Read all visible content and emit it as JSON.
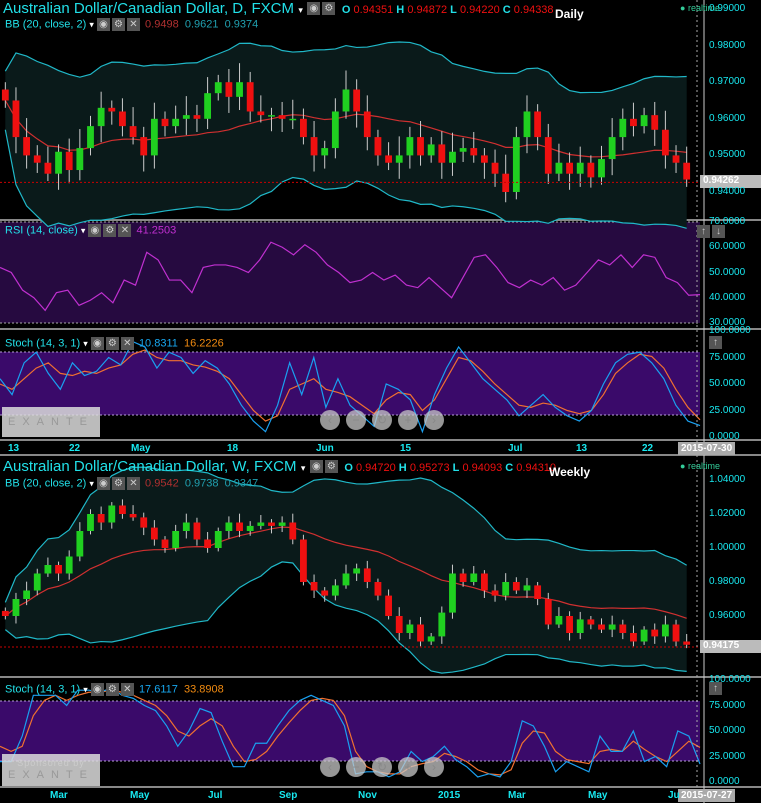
{
  "daily": {
    "title": "Australian Dollar/Canadian Dollar, D, FXCM",
    "ohlc": {
      "o_label": "O",
      "o": "0.94351",
      "h_label": "H",
      "h": "0.94872",
      "l_label": "L",
      "l": "0.94220",
      "c_label": "C",
      "c": "0.94338"
    },
    "timeframe": "Daily",
    "realtime": "realtime",
    "bb": {
      "label": "BB (20, close, 2)",
      "mid": "0.9498",
      "upper": "0.9621",
      "lower": "0.9374"
    },
    "rsi": {
      "label": "RSI (14, close)",
      "value": "41.2503"
    },
    "stoch": {
      "label": "Stoch (14, 3, 1)",
      "k": "10.8311",
      "d": "16.2226"
    },
    "price_axis": [
      "0.99000",
      "0.98000",
      "0.97000",
      "0.96000",
      "0.95000",
      "0.94000"
    ],
    "price_ticks": [
      0.99,
      0.98,
      0.97,
      0.96,
      0.95,
      0.94
    ],
    "last_price": "0.94262",
    "rsi_axis": [
      "70.0000",
      "60.0000",
      "50.0000",
      "40.0000",
      "30.0000"
    ],
    "stoch_axis": [
      "100.0000",
      "75.0000",
      "50.0000",
      "25.0000",
      "0.0000"
    ],
    "time_axis": [
      "13",
      "22",
      "May",
      "18",
      "Jun",
      "15",
      "Jul",
      "13",
      "22"
    ],
    "cursor_date": "2015-07-30",
    "closes": [
      0.965,
      0.955,
      0.95,
      0.948,
      0.945,
      0.951,
      0.946,
      0.952,
      0.958,
      0.963,
      0.962,
      0.958,
      0.955,
      0.95,
      0.96,
      0.958,
      0.96,
      0.961,
      0.96,
      0.967,
      0.97,
      0.966,
      0.97,
      0.962,
      0.961,
      0.961,
      0.96,
      0.96,
      0.955,
      0.95,
      0.952,
      0.962,
      0.968,
      0.962,
      0.955,
      0.95,
      0.948,
      0.95,
      0.955,
      0.95,
      0.953,
      0.948,
      0.951,
      0.952,
      0.95,
      0.948,
      0.945,
      0.94,
      0.955,
      0.962,
      0.955,
      0.945,
      0.948,
      0.945,
      0.948,
      0.944,
      0.949,
      0.955,
      0.96,
      0.958,
      0.961,
      0.957,
      0.95,
      0.948,
      0.9434
    ],
    "rsi_values": [
      52,
      50,
      43,
      40,
      35,
      42,
      43,
      37,
      39,
      42,
      38,
      47,
      45,
      58,
      55,
      47,
      47,
      42,
      52,
      53,
      53,
      52,
      50,
      55,
      62,
      60,
      57,
      61,
      58,
      53,
      50,
      46,
      47,
      50,
      47,
      49,
      45,
      44,
      48,
      44,
      40,
      48,
      56,
      57,
      52,
      46,
      44,
      47,
      45,
      48,
      43,
      45,
      50,
      55,
      53,
      57,
      52,
      57,
      56,
      48,
      46,
      41,
      41.25
    ],
    "stoch_k": [
      55,
      40,
      70,
      80,
      60,
      45,
      70,
      58,
      62,
      75,
      68,
      90,
      85,
      65,
      80,
      75,
      60,
      72,
      65,
      50,
      30,
      15,
      5,
      30,
      70,
      40,
      75,
      28,
      55,
      30,
      20,
      10,
      50,
      45,
      35,
      5,
      40,
      65,
      85,
      70,
      55,
      45,
      35,
      20,
      30,
      40,
      28,
      20,
      15,
      25,
      50,
      70,
      78,
      80,
      70,
      55,
      30,
      15,
      10.83
    ],
    "stoch_d": [
      50,
      45,
      55,
      65,
      70,
      60,
      58,
      62,
      60,
      65,
      68,
      78,
      82,
      75,
      72,
      72,
      68,
      66,
      62,
      55,
      40,
      25,
      15,
      20,
      45,
      50,
      55,
      45,
      42,
      38,
      30,
      22,
      35,
      42,
      40,
      25,
      35,
      55,
      75,
      72,
      62,
      50,
      40,
      30,
      28,
      32,
      30,
      25,
      22,
      25,
      40,
      60,
      70,
      78,
      76,
      65,
      45,
      28,
      16.22
    ]
  },
  "weekly": {
    "title": "Australian Dollar/Canadian Dollar, W, FXCM",
    "ohlc": {
      "o_label": "O",
      "o": "0.94720",
      "h_label": "H",
      "h": "0.95273",
      "l_label": "L",
      "l": "0.94093",
      "c_label": "C",
      "c": "0.94310"
    },
    "timeframe": "Weekly",
    "realtime": "realtime",
    "bb": {
      "label": "BB (20, close, 2)",
      "mid": "0.9542",
      "upper": "0.9738",
      "lower": "0.9347"
    },
    "stoch": {
      "label": "Stoch (14, 3, 1)",
      "k": "17.6117",
      "d": "33.8908"
    },
    "price_axis": [
      "1.04000",
      "1.02000",
      "1.00000",
      "0.98000",
      "0.96000"
    ],
    "price_ticks": [
      1.04,
      1.02,
      1.0,
      0.98,
      0.96
    ],
    "last_price": "0.94175",
    "stoch_axis": [
      "100.0000",
      "75.0000",
      "50.0000",
      "25.0000",
      "0.0000"
    ],
    "time_axis": [
      "Mar",
      "May",
      "Jul",
      "Sep",
      "Nov",
      "2015",
      "Mar",
      "May",
      "Ju"
    ],
    "cursor_date": "2015-07-27",
    "closes": [
      0.96,
      0.97,
      0.975,
      0.985,
      0.99,
      0.985,
      0.995,
      1.01,
      1.02,
      1.015,
      1.025,
      1.02,
      1.018,
      1.012,
      1.005,
      1.0,
      1.01,
      1.015,
      1.005,
      1.0,
      1.01,
      1.015,
      1.01,
      1.013,
      1.015,
      1.013,
      1.015,
      1.005,
      0.98,
      0.975,
      0.972,
      0.978,
      0.985,
      0.988,
      0.98,
      0.972,
      0.96,
      0.95,
      0.955,
      0.945,
      0.948,
      0.962,
      0.985,
      0.98,
      0.985,
      0.975,
      0.972,
      0.98,
      0.975,
      0.978,
      0.97,
      0.955,
      0.96,
      0.95,
      0.958,
      0.955,
      0.952,
      0.955,
      0.95,
      0.945,
      0.952,
      0.948,
      0.955,
      0.945,
      0.9431
    ],
    "stoch_k": [
      20,
      20,
      45,
      85,
      85,
      85,
      75,
      90,
      90,
      88,
      92,
      85,
      82,
      75,
      70,
      55,
      35,
      50,
      72,
      68,
      40,
      15,
      15,
      38,
      38,
      55,
      70,
      80,
      85,
      80,
      75,
      55,
      8,
      10,
      10,
      5,
      10,
      30,
      20,
      25,
      35,
      22,
      15,
      5,
      8,
      5,
      20,
      60,
      55,
      35,
      10,
      20,
      15,
      10,
      45,
      30,
      30,
      50,
      20,
      25,
      15,
      50,
      45,
      17.61
    ],
    "stoch_d": [
      35,
      30,
      35,
      65,
      80,
      85,
      80,
      85,
      88,
      88,
      90,
      88,
      85,
      80,
      75,
      65,
      50,
      45,
      55,
      62,
      55,
      35,
      20,
      22,
      30,
      45,
      58,
      70,
      80,
      82,
      80,
      65,
      30,
      15,
      10,
      8,
      8,
      15,
      18,
      20,
      28,
      25,
      20,
      12,
      8,
      7,
      12,
      38,
      50,
      48,
      30,
      22,
      20,
      18,
      30,
      32,
      30,
      40,
      32,
      25,
      20,
      30,
      40,
      33.89
    ]
  },
  "overlay": {
    "sponsor": "Sponsored by",
    "brand": "EXANTE",
    "nav": [
      "‹",
      "−",
      "↻",
      "+",
      "›"
    ]
  },
  "colors": {
    "bull": "#20d020",
    "bear": "#f01010",
    "band": "#20b8c8",
    "mid": "#d03030",
    "rsi": "#c030d0",
    "k": "#1aa0f0",
    "d": "#f07030",
    "osc_bg": "#3a0a6a",
    "rsi_bg": "#260a40"
  }
}
